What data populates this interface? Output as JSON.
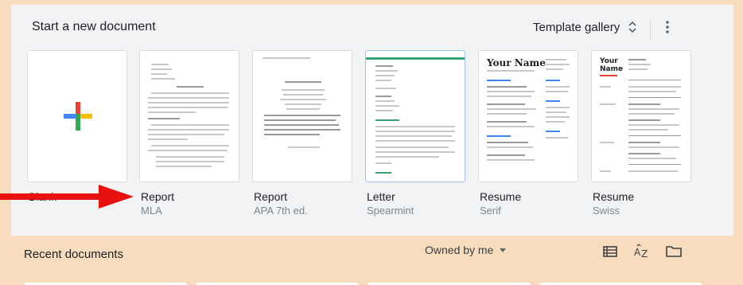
{
  "header": {
    "title": "Start a new document",
    "gallery_label": "Template gallery"
  },
  "templates": [
    {
      "name": "Blank",
      "sub": ""
    },
    {
      "name": "Report",
      "sub": "MLA"
    },
    {
      "name": "Report",
      "sub": "APA 7th ed."
    },
    {
      "name": "Letter",
      "sub": "Spearmint"
    },
    {
      "name": "Resume",
      "sub": "Serif"
    },
    {
      "name": "Resume",
      "sub": "Swiss"
    }
  ],
  "thumbs": {
    "resume_serif_title": "Your Name",
    "resume_swiss_title_1": "Your",
    "resume_swiss_title_2": "Name",
    "apa_title": "Title of the Paper"
  },
  "recent": {
    "title": "Recent documents",
    "owner_filter": "Owned by me"
  },
  "colors": {
    "background": "#f7dcbd",
    "panel": "#f1f3f4",
    "arrow": "#e8110f",
    "accent_blue": "#4285f4",
    "accent_red": "#ea4335",
    "accent_yellow": "#fbbc04",
    "accent_green": "#34a853"
  },
  "icons": [
    "unfold-icon",
    "more-vert-icon",
    "plus-icon",
    "list-view-icon",
    "sort-az-icon",
    "folder-icon",
    "arrow-annotation"
  ]
}
